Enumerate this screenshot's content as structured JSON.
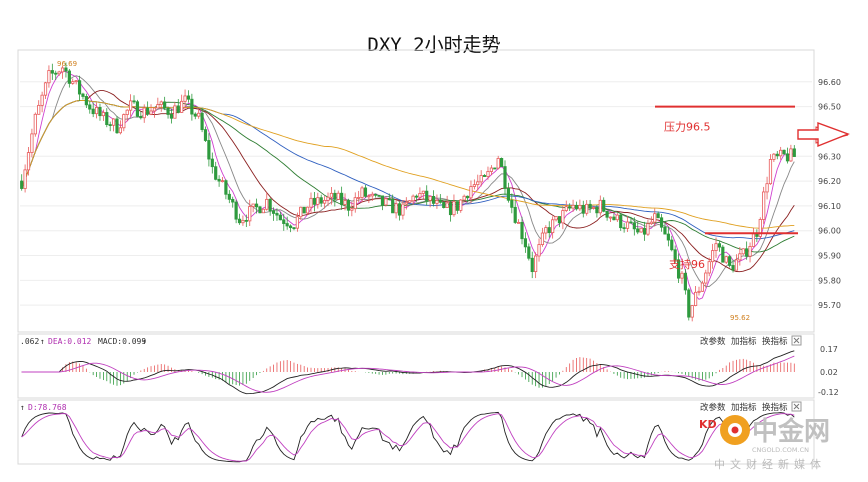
{
  "title": "DXY 2小时走势",
  "main": {
    "yticks": [
      {
        "v": 95.7,
        "t": "95.70"
      },
      {
        "v": 95.8,
        "t": "95.80"
      },
      {
        "v": 95.9,
        "t": "95.90"
      },
      {
        "v": 96.0,
        "t": "96.00"
      },
      {
        "v": 96.1,
        "t": "96.10"
      },
      {
        "v": 96.2,
        "t": "96.20"
      },
      {
        "v": 96.3,
        "t": "96.30"
      },
      {
        "v": 96.5,
        "t": "96.50"
      },
      {
        "v": 96.6,
        "t": "96.60"
      }
    ],
    "high_label": "96.69",
    "low_label": "95.62",
    "resistance": {
      "label": "压力96.5",
      "value": 96.5
    },
    "support": {
      "label": "支持96",
      "value": 95.99
    }
  },
  "macd": {
    "label_prefix": ".062",
    "dea": "DEA:0.012",
    "macd": "MACD:0.099",
    "yticks": [
      "0.17",
      "0.02",
      "-0.12"
    ],
    "buttons": [
      "改参数",
      "加指标",
      "换指标"
    ]
  },
  "kdj": {
    "label": "D:78.768",
    "buttons": [
      "改参数",
      "加指标",
      "换指标"
    ],
    "overlay_text": "KD"
  },
  "watermark": {
    "site": "CNGOLD.COM.CN",
    "cn": "中文财经新媒体",
    "logo_text": "中金网"
  },
  "colors": {
    "up": "#e85a5a",
    "down": "#2e9a3e",
    "accent": "#e03030"
  },
  "chart_data": {
    "type": "candlestick",
    "title": "DXY 2小时走势",
    "ylim": [
      95.6,
      96.72
    ],
    "candles_ohlc_summary": {
      "high": 96.69,
      "low": 95.62
    },
    "series": [
      {
        "values": [
          96.2,
          96.18,
          96.15,
          96.13,
          96.1,
          96.08,
          96.06,
          96.03,
          96.02,
          96.03,
          96.05,
          96.08,
          96.12,
          96.18,
          96.25
        ]
      },
      {
        "values": [
          96.26,
          96.28,
          96.3,
          96.31,
          96.31,
          96.3,
          96.29,
          96.27,
          96.25,
          96.22,
          96.21,
          96.2,
          96.2,
          96.2,
          96.2
        ]
      }
    ],
    "annotations": [
      "压力96.5",
      "支持96",
      "96.69",
      "95.62"
    ]
  }
}
